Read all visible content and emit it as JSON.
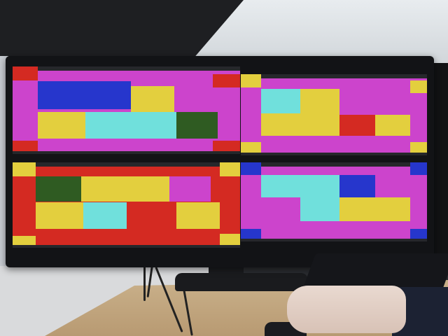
{
  "colors": {
    "magenta": "#cc44cc",
    "red": "#d42a22",
    "yellow": "#e3cf3e",
    "blue": "#2636cc",
    "cyan": "#70e0dc",
    "dark_green": "#2f5b22",
    "bezel": "#121316"
  },
  "panes": [
    {
      "id": "top-left",
      "background": "magenta",
      "blocks": [
        {
          "color": "red",
          "name": "corner-top-left-block"
        },
        {
          "color": "red",
          "name": "corner-top-right-block"
        },
        {
          "color": "red",
          "name": "corner-bottom-left-block"
        },
        {
          "color": "red",
          "name": "corner-bottom-right-block"
        },
        {
          "color": "blue",
          "name": "blue-block"
        },
        {
          "color": "yellow",
          "name": "yellow-block-top"
        },
        {
          "color": "yellow",
          "name": "yellow-block-left"
        },
        {
          "color": "cyan",
          "name": "cyan-block"
        },
        {
          "color": "dark_green",
          "name": "green-block"
        }
      ]
    },
    {
      "id": "top-right",
      "background": "magenta",
      "blocks": [
        {
          "color": "yellow",
          "name": "corner-top-left-block"
        },
        {
          "color": "yellow",
          "name": "corner-top-right-block"
        },
        {
          "color": "yellow",
          "name": "corner-bottom-left-block"
        },
        {
          "color": "yellow",
          "name": "corner-bottom-right-block"
        },
        {
          "color": "cyan",
          "name": "cyan-block"
        },
        {
          "color": "yellow",
          "name": "yellow-l-block-top"
        },
        {
          "color": "yellow",
          "name": "yellow-l-block-bottom"
        },
        {
          "color": "red",
          "name": "red-block"
        },
        {
          "color": "yellow",
          "name": "yellow-block-right"
        }
      ]
    },
    {
      "id": "bottom-left",
      "background": "red",
      "blocks": [
        {
          "color": "yellow",
          "name": "corner-top-left-block"
        },
        {
          "color": "yellow",
          "name": "corner-top-right-block"
        },
        {
          "color": "yellow",
          "name": "corner-bottom-left-block"
        },
        {
          "color": "yellow",
          "name": "corner-bottom-right-block"
        },
        {
          "color": "dark_green",
          "name": "green-block"
        },
        {
          "color": "yellow",
          "name": "yellow-block-top"
        },
        {
          "color": "magenta",
          "name": "magenta-block"
        },
        {
          "color": "yellow",
          "name": "yellow-block-left"
        },
        {
          "color": "cyan",
          "name": "cyan-block"
        },
        {
          "color": "yellow",
          "name": "yellow-block-right"
        }
      ]
    },
    {
      "id": "bottom-right",
      "background": "magenta",
      "blocks": [
        {
          "color": "blue",
          "name": "corner-top-left-block"
        },
        {
          "color": "blue",
          "name": "corner-top-right-block"
        },
        {
          "color": "blue",
          "name": "corner-bottom-left-block"
        },
        {
          "color": "blue",
          "name": "corner-bottom-right-block"
        },
        {
          "color": "cyan",
          "name": "cyan-block-top"
        },
        {
          "color": "cyan",
          "name": "cyan-block-bottom"
        },
        {
          "color": "blue",
          "name": "blue-block"
        },
        {
          "color": "yellow",
          "name": "yellow-block"
        }
      ]
    }
  ]
}
